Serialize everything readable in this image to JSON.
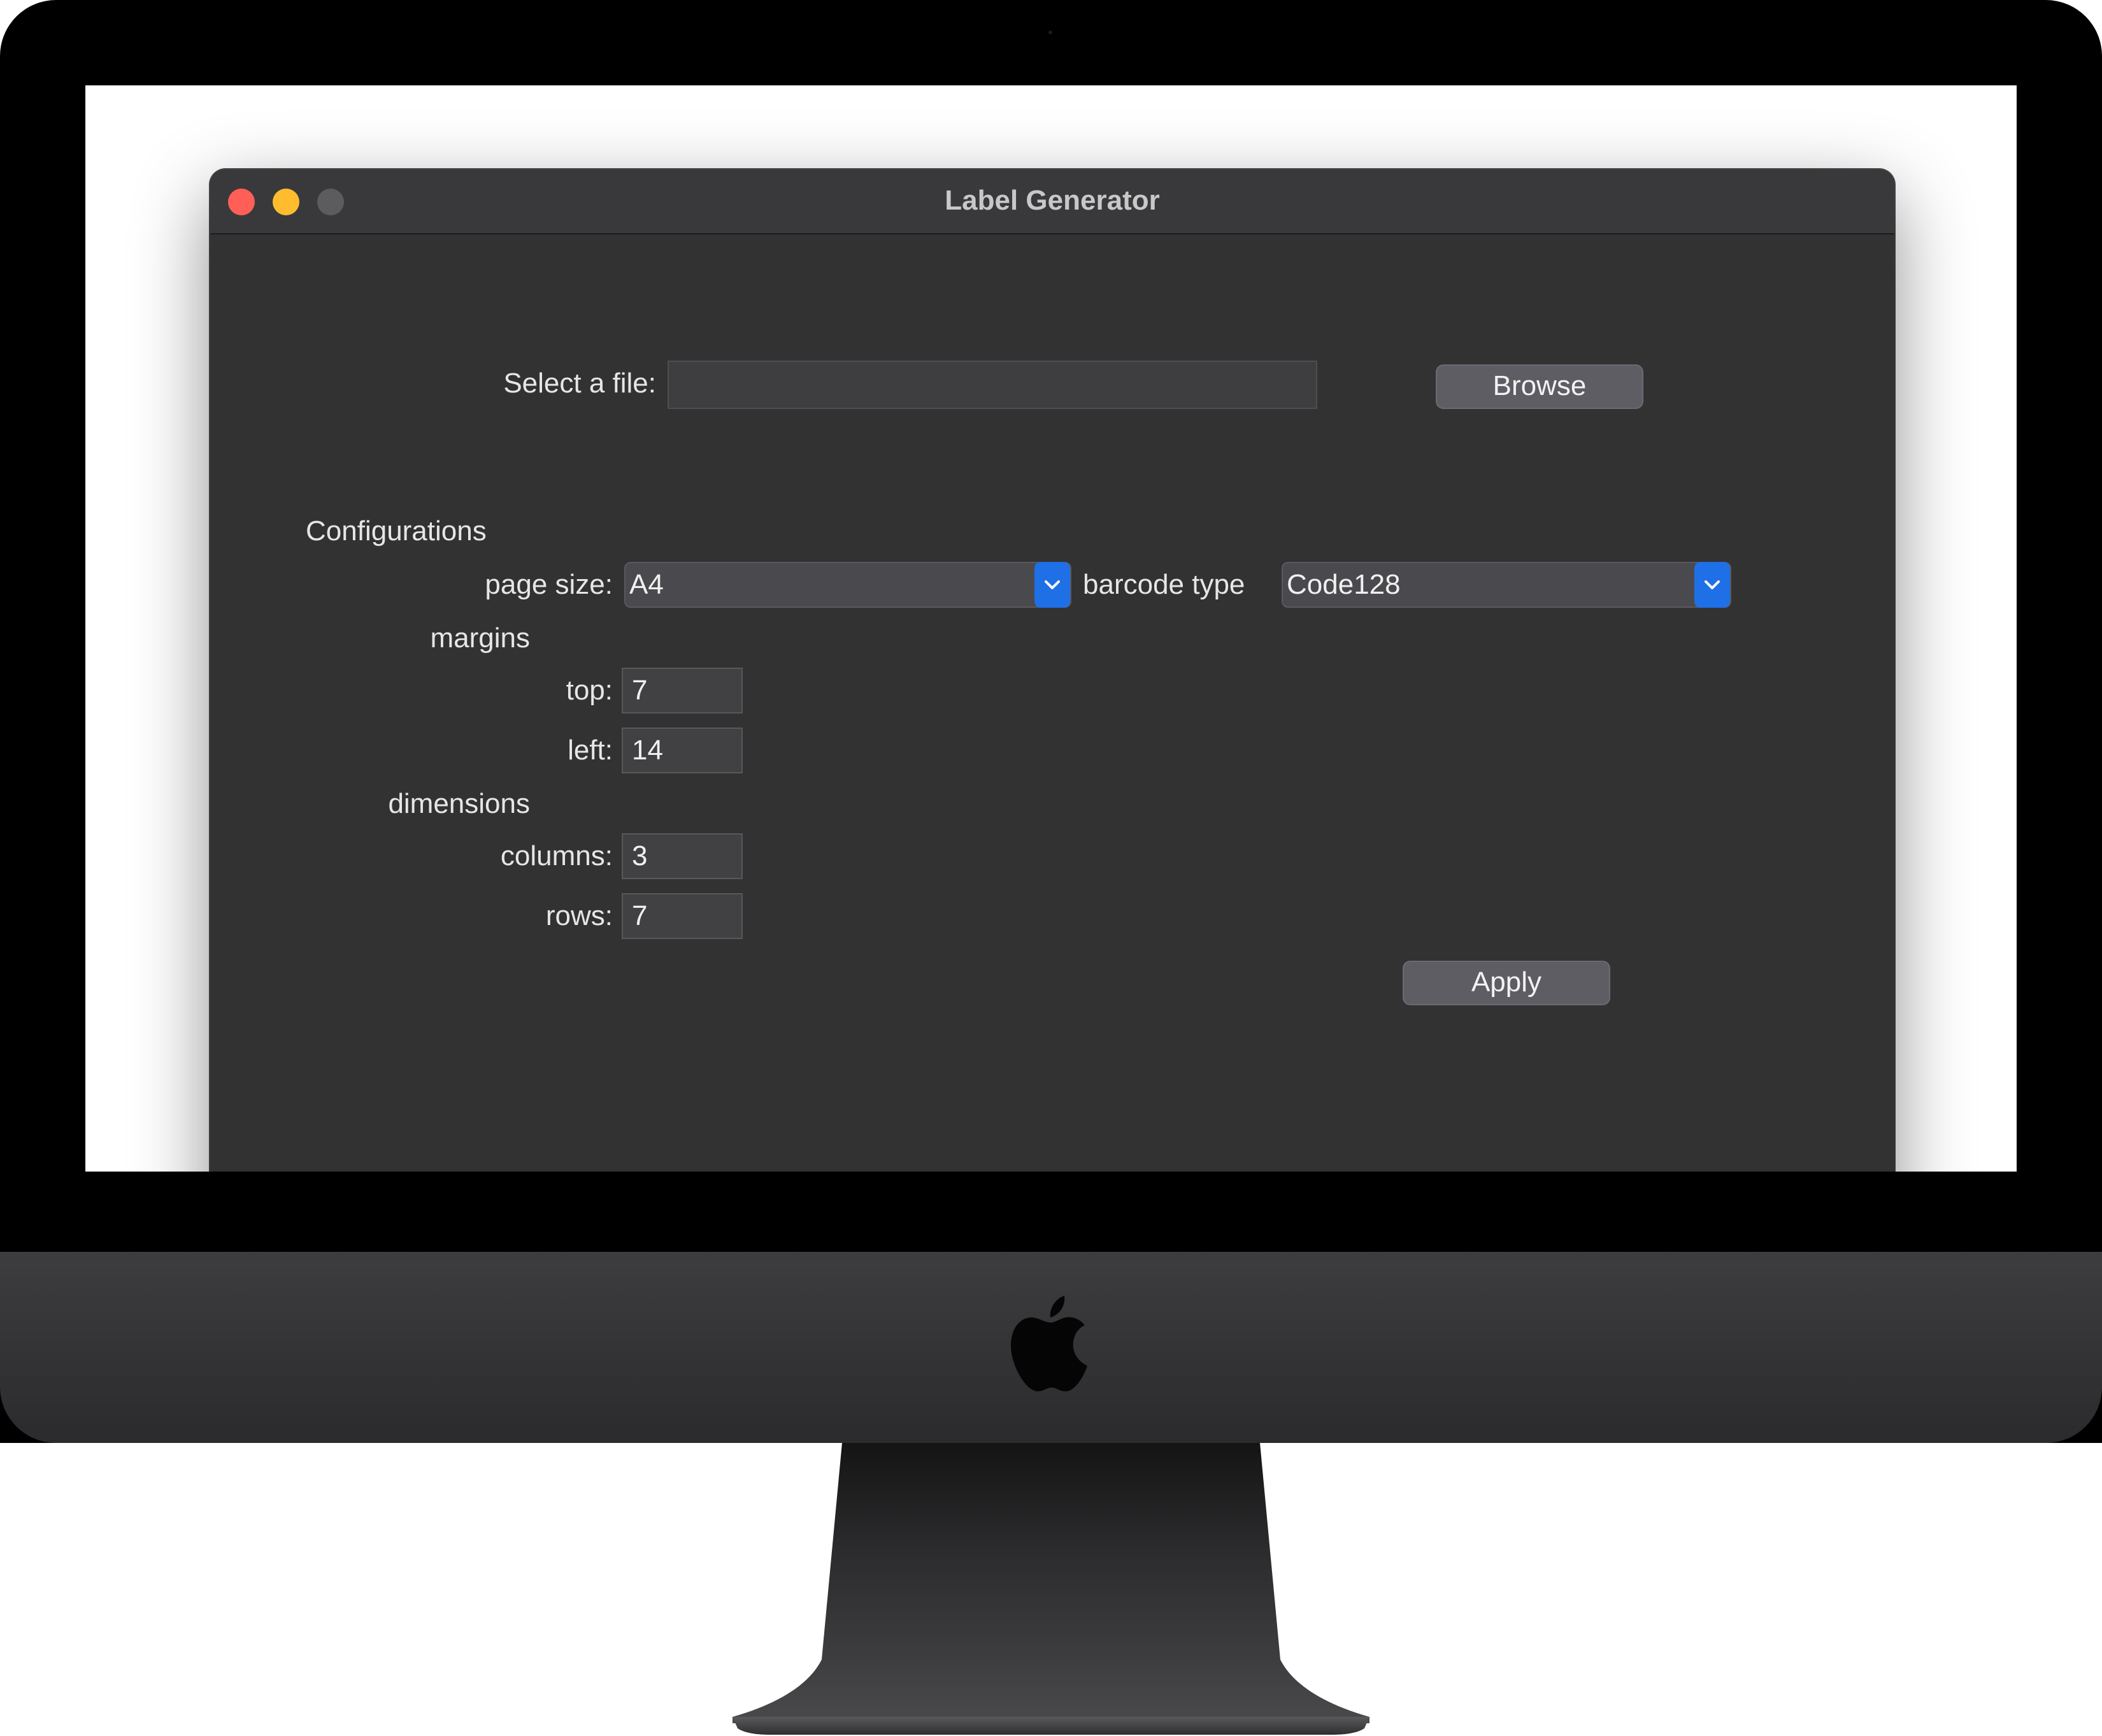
{
  "window": {
    "title": "Label Generator"
  },
  "file": {
    "label": "Select a file:",
    "value": "",
    "browse_label": "Browse"
  },
  "config": {
    "heading": "Configurations",
    "page_size_label": "page size:",
    "page_size_value": "A4",
    "barcode_label": "barcode type",
    "barcode_value": "Code128"
  },
  "margins": {
    "heading": "margins",
    "top_label": "top:",
    "top_value": "7",
    "left_label": "left:",
    "left_value": "14"
  },
  "dimensions": {
    "heading": "dimensions",
    "columns_label": "columns:",
    "columns_value": "3",
    "rows_label": "rows:",
    "rows_value": "7"
  },
  "actions": {
    "apply_label": "Apply"
  },
  "colors": {
    "window_bg": "#323233",
    "accent": "#1f6fe6",
    "close": "#ff5f57",
    "minimize": "#febc2e"
  },
  "icons": [
    "apple-logo-icon",
    "chevron-down-icon"
  ]
}
